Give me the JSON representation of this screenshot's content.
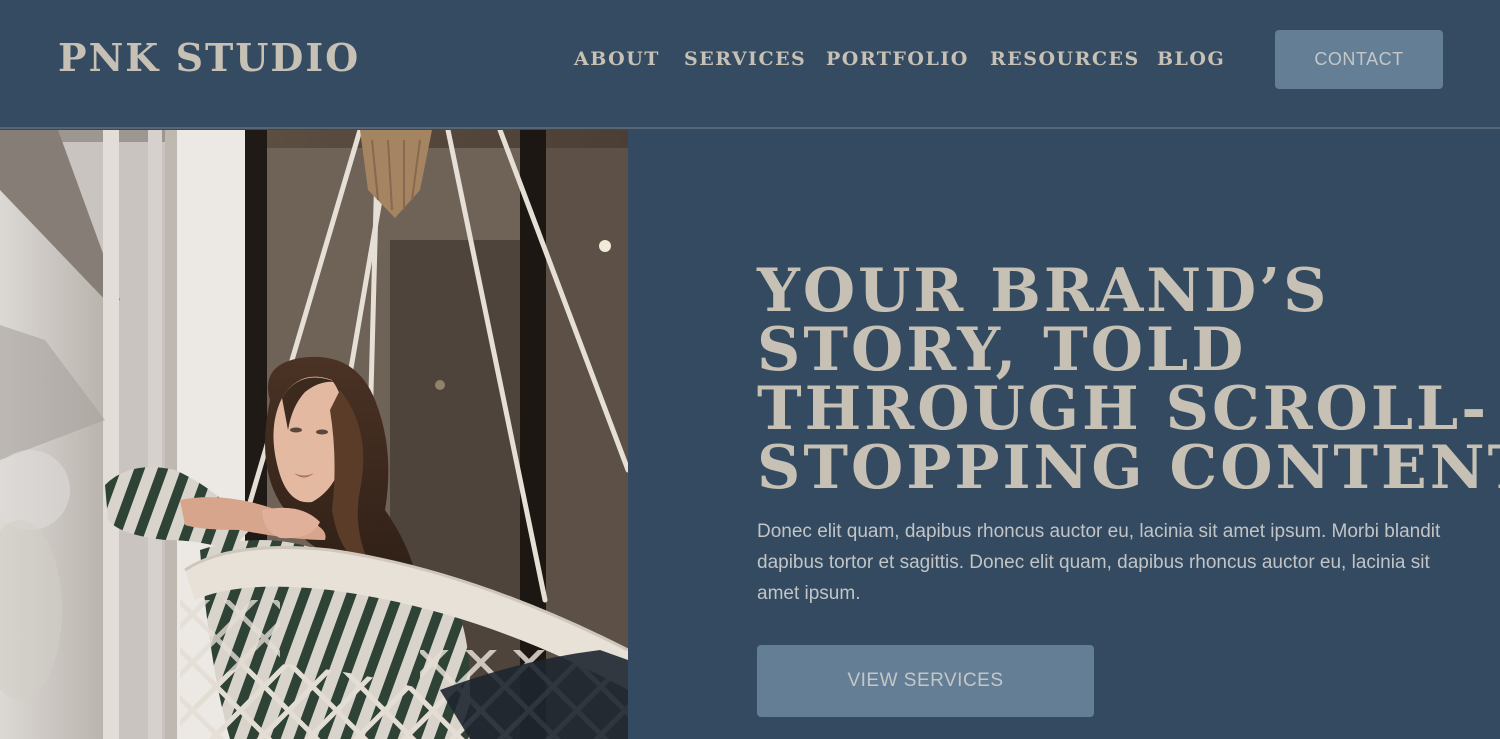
{
  "header": {
    "logo": "PNK STUDIO",
    "nav": {
      "about": "ABOUT",
      "services": "SERVICES",
      "portfolio": "PORTFOLIO",
      "resources": "RESOURCES",
      "blog": "BLOG"
    },
    "contact_label": "CONTACT"
  },
  "hero": {
    "title_lines": [
      "YOUR BRAND’S",
      "STORY, TOLD",
      "THROUGH SCROLL-",
      "STOPPING CONTENT"
    ],
    "body": "Donec elit quam, dapibus rhoncus auctor eu, lacinia sit amet ipsum. Morbi blandit dapibus tortor et sagittis. Donec elit quam, dapibus rhoncus auctor eu, lacinia sit amet ipsum.",
    "cta_label": "VIEW SERVICES"
  },
  "colors": {
    "background": "#334a60",
    "heading_text": "#c7c0b4",
    "button_bg": "#647e95",
    "button_text": "#c4c7c8"
  }
}
